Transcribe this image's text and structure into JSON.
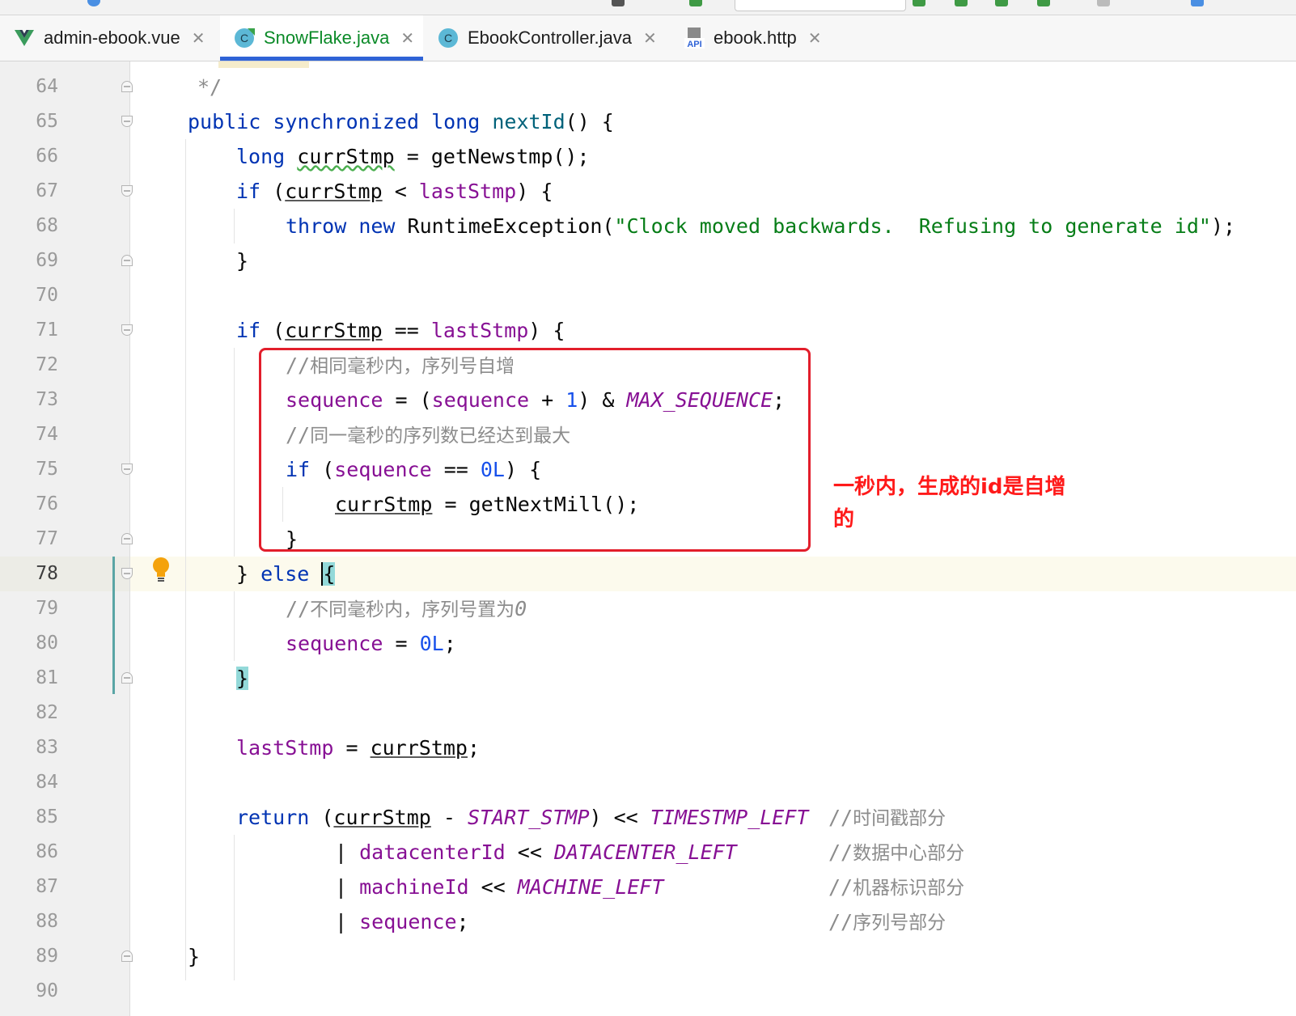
{
  "tabs": [
    {
      "label": "admin-ebook.vue",
      "icon": "vue-file-icon",
      "active": false
    },
    {
      "label": "SnowFlake.java",
      "icon": "java-class-icon",
      "active": true
    },
    {
      "label": "EbookController.java",
      "icon": "java-class-icon",
      "active": false
    },
    {
      "label": "ebook.http",
      "icon": "api-file-icon",
      "active": false
    }
  ],
  "tab_close_glyph": "✕",
  "api_icon_text": "API",
  "class_icon_letter": "C",
  "current_line": 78,
  "line_numbers": [
    "64",
    "65",
    "66",
    "67",
    "68",
    "69",
    "70",
    "71",
    "72",
    "73",
    "74",
    "75",
    "76",
    "77",
    "78",
    "79",
    "80",
    "81",
    "82",
    "83",
    "84",
    "85",
    "86",
    "87",
    "88",
    "89",
    "90"
  ],
  "code": {
    "l64": "*/",
    "l65": {
      "kw1": "public",
      "kw2": "synchronized",
      "kw3": "long",
      "fn": "nextId",
      "rest": "() {"
    },
    "l66": {
      "kw": "long",
      "var": "currStmp",
      "rest": " = getNewstmp();"
    },
    "l67": {
      "kw": "if",
      "open": " (",
      "var": "currStmp",
      "op": " < ",
      "fld": "lastStmp",
      "rest": ") {"
    },
    "l68": {
      "kw1": "throw",
      "kw2": "new",
      "cls": "RuntimeException(",
      "str": "\"Clock moved backwards.  Refusing to generate id\"",
      "rest": ");"
    },
    "l69": "}",
    "l71": {
      "kw": "if",
      "open": " (",
      "var": "currStmp",
      "op": " == ",
      "fld": "lastStmp",
      "rest": ") {"
    },
    "l72": {
      "slashes": "//",
      "text": "相同毫秒内，序列号自增"
    },
    "l73": {
      "fld1": "sequence",
      "op1": " = (",
      "fld2": "sequence",
      "op2": " + ",
      "num": "1",
      "op3": ") & ",
      "cst": "MAX_SEQUENCE",
      "rest": ";"
    },
    "l74": {
      "slashes": "//",
      "text": "同一毫秒的序列数已经达到最大"
    },
    "l75": {
      "kw": "if",
      "open": " (",
      "fld": "sequence",
      "op": " == ",
      "num": "0L",
      "rest": ") {"
    },
    "l76": {
      "var": "currStmp",
      "rest": " = getNextMill();"
    },
    "l77": "}",
    "l78": {
      "pre": "} ",
      "kw": "else",
      "brace": "{"
    },
    "l79": {
      "slashes": "//",
      "text": "不同毫秒内，序列号置为",
      "tail": "0"
    },
    "l80": {
      "fld": "sequence",
      "op": " = ",
      "num": "0L",
      "rest": ";"
    },
    "l81": "}",
    "l83": {
      "fld": "lastStmp",
      "op": " = ",
      "var": "currStmp",
      "rest": ";"
    },
    "l85": {
      "kw": "return",
      "open": " (",
      "var": "currStmp",
      "op1": " - ",
      "cst1": "START_STMP",
      "op2": ") << ",
      "cst2": "TIMESTMP_LEFT",
      "cmt_slashes": "//",
      "cmt": "时间戳部分"
    },
    "l86": {
      "bar": "| ",
      "fld": "datacenterId",
      "op": " << ",
      "cst": "DATACENTER_LEFT",
      "cmt_slashes": "//",
      "cmt": "数据中心部分"
    },
    "l87": {
      "bar": "| ",
      "fld": "machineId",
      "op": " << ",
      "cst": "MACHINE_LEFT",
      "cmt_slashes": "//",
      "cmt": "机器标识部分"
    },
    "l88": {
      "bar": "| ",
      "fld": "sequence",
      "rest": ";",
      "cmt_slashes": "//",
      "cmt": "序列号部分"
    },
    "l89": "}"
  },
  "annotation": "一秒内，生成的id是自增的",
  "colors": {
    "keyword": "#0033b3",
    "field": "#871094",
    "string": "#067d17",
    "number": "#1750eb",
    "comment": "#8c8c8c",
    "annotation": "#ff1a1a",
    "highlight_box": "#e21e2b",
    "active_tab_underline": "#2f63d6"
  }
}
